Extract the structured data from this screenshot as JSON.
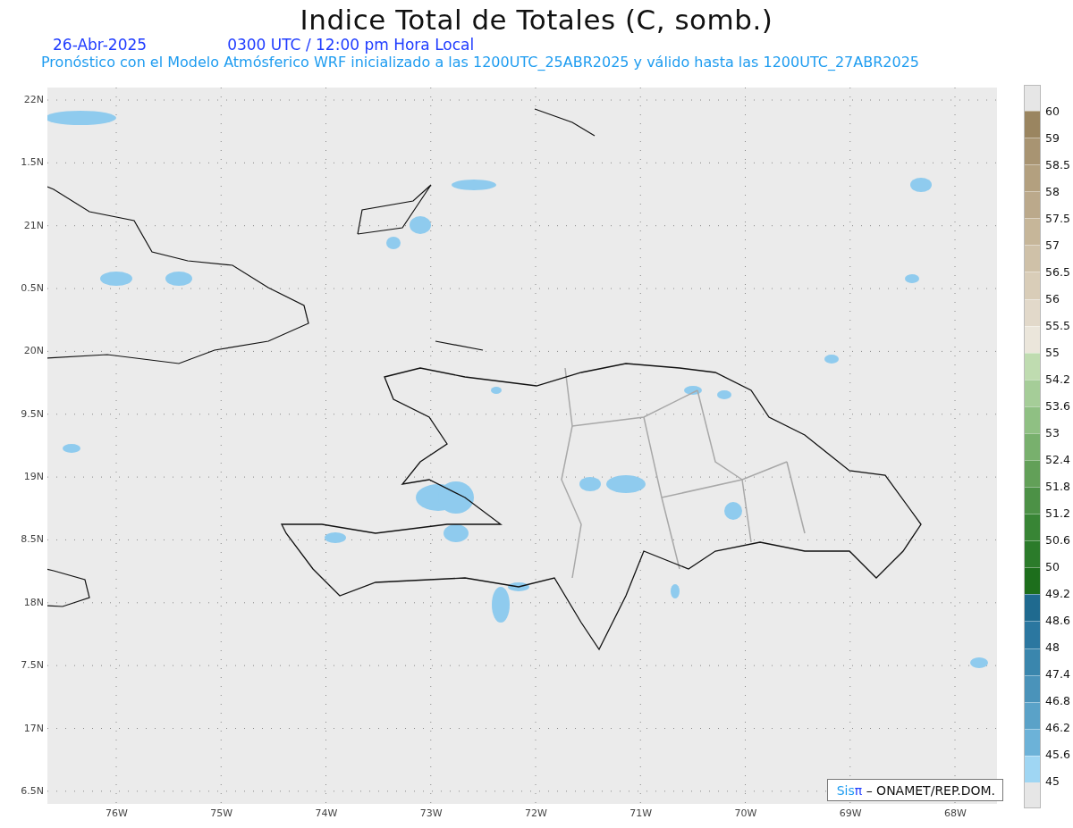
{
  "title": "Indice Total de Totales (C, somb.)",
  "date": "26-Abr-2025",
  "time": "0300 UTC / 12:00 pm Hora Local",
  "subtitle": "Pronóstico con el Modelo Atmósferico WRF inicializado a las 1200UTC_25ABR2025 y válido hasta las  1200UTC_27ABR2025",
  "y_ticks": [
    "22N",
    "1.5N",
    "21N",
    "0.5N",
    "20N",
    "9.5N",
    "19N",
    "8.5N",
    "18N",
    "7.5N",
    "17N",
    "6.5N"
  ],
  "x_ticks": [
    "76W",
    "75W",
    "74W",
    "73W",
    "72W",
    "71W",
    "70W",
    "69W",
    "68W"
  ],
  "colorbar": {
    "labels": [
      "60",
      "59",
      "58.5",
      "58",
      "57.5",
      "57",
      "56.5",
      "56",
      "55.5",
      "55",
      "54.2",
      "53.6",
      "53",
      "52.4",
      "51.8",
      "51.2",
      "50.6",
      "50",
      "49.2",
      "48.6",
      "48",
      "47.4",
      "46.8",
      "46.2",
      "45.6",
      "45"
    ],
    "bins": [
      {
        "color": "#9a8560"
      },
      {
        "color": "#a89472"
      },
      {
        "color": "#b3a07f"
      },
      {
        "color": "#bba98b"
      },
      {
        "color": "#c6b699"
      },
      {
        "color": "#cfc1a8"
      },
      {
        "color": "#d9cdb8"
      },
      {
        "color": "#e2d9ca"
      },
      {
        "color": "#ebe6db"
      },
      {
        "color": "#bfdcb0"
      },
      {
        "color": "#a5cd98"
      },
      {
        "color": "#8fc083"
      },
      {
        "color": "#78b06d"
      },
      {
        "color": "#62a058"
      },
      {
        "color": "#4c9146"
      },
      {
        "color": "#388535"
      },
      {
        "color": "#2b7b2a"
      },
      {
        "color": "#1d6e1c"
      },
      {
        "color": "#1f6a8f"
      },
      {
        "color": "#2b77a0"
      },
      {
        "color": "#3a86ad"
      },
      {
        "color": "#4a93ba"
      },
      {
        "color": "#5aa2c8"
      },
      {
        "color": "#6cb2d8"
      },
      {
        "color": "#9fd6f3"
      }
    ]
  },
  "credit": {
    "brand": "Sis",
    "brand_mark": "π",
    "text": "– ONAMET/REP.DOM."
  }
}
